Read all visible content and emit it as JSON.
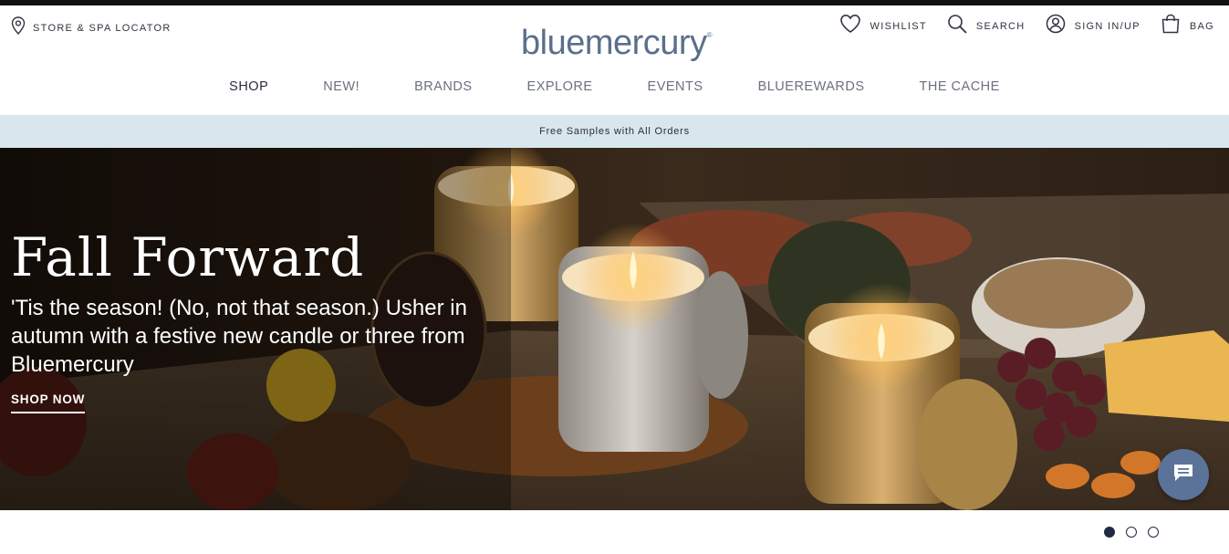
{
  "utility_left": {
    "store_locator": "STORE & SPA LOCATOR"
  },
  "logo": {
    "text": "bluemercury",
    "mark": "®"
  },
  "utility_right": {
    "wishlist": "WISHLIST",
    "search": "SEARCH",
    "sign_in": "SIGN IN/UP",
    "bag": "BAG"
  },
  "nav": {
    "items": [
      {
        "label": "SHOP"
      },
      {
        "label": "NEW!"
      },
      {
        "label": "BRANDS"
      },
      {
        "label": "EXPLORE"
      },
      {
        "label": "EVENTS"
      },
      {
        "label": "BLUEREWARDS"
      },
      {
        "label": "THE CACHE"
      }
    ],
    "active_index": 0
  },
  "promo": {
    "text": "Free Samples with All Orders"
  },
  "hero": {
    "title": "Fall Forward",
    "subtitle": "'Tis the season! (No, not that season.) Usher in autumn with a festive new candle or three from Bluemercury",
    "cta": "SHOP NOW"
  },
  "carousel": {
    "slides": 3,
    "active": 1
  },
  "icons": {
    "store": "map-pin-icon",
    "wishlist": "heart-icon",
    "search": "search-icon",
    "sign_in": "user-icon",
    "bag": "shopping-bag-icon",
    "chat": "chat-icon"
  },
  "colors": {
    "logo": "#5a6f8c",
    "promo_bg": "#d8e6ee",
    "chat": "#5b7399",
    "dot": "#1f2a44"
  }
}
